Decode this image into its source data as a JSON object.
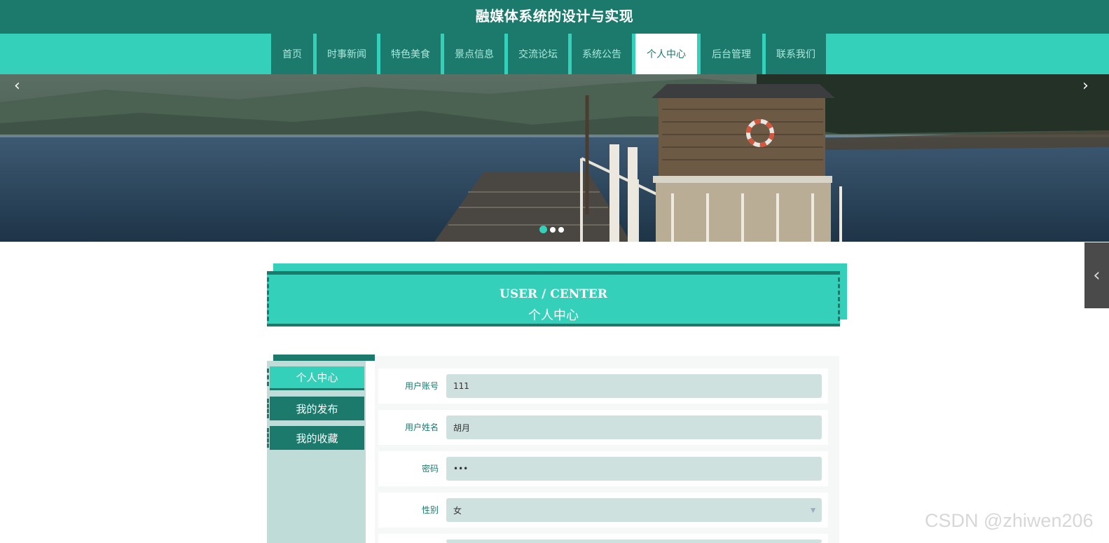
{
  "site": {
    "title": "融媒体系统的设计与实现"
  },
  "nav": {
    "items": [
      {
        "label": "首页"
      },
      {
        "label": "时事新闻"
      },
      {
        "label": "特色美食"
      },
      {
        "label": "景点信息"
      },
      {
        "label": "交流论坛"
      },
      {
        "label": "系统公告"
      },
      {
        "label": "个人中心"
      },
      {
        "label": "后台管理"
      },
      {
        "label": "联系我们"
      }
    ],
    "active_index": 6
  },
  "banner": {
    "slide_count": 3,
    "active_slide": 0
  },
  "section": {
    "title_en": "USER / CENTER",
    "title_cn": "个人中心"
  },
  "sidebar": {
    "items": [
      {
        "label": "个人中心"
      },
      {
        "label": "我的发布"
      },
      {
        "label": "我的收藏"
      }
    ],
    "active_index": 0
  },
  "form": {
    "username": {
      "label": "用户账号",
      "value": "111"
    },
    "name": {
      "label": "用户姓名",
      "value": "胡月"
    },
    "password": {
      "label": "密码",
      "value": "•••"
    },
    "gender": {
      "label": "性别",
      "value": "女"
    }
  },
  "watermark": "CSDN @zhiwen206",
  "colors": {
    "dark_teal": "#1c7a6c",
    "teal": "#35d0b9",
    "input_bg": "#cfe1de"
  }
}
